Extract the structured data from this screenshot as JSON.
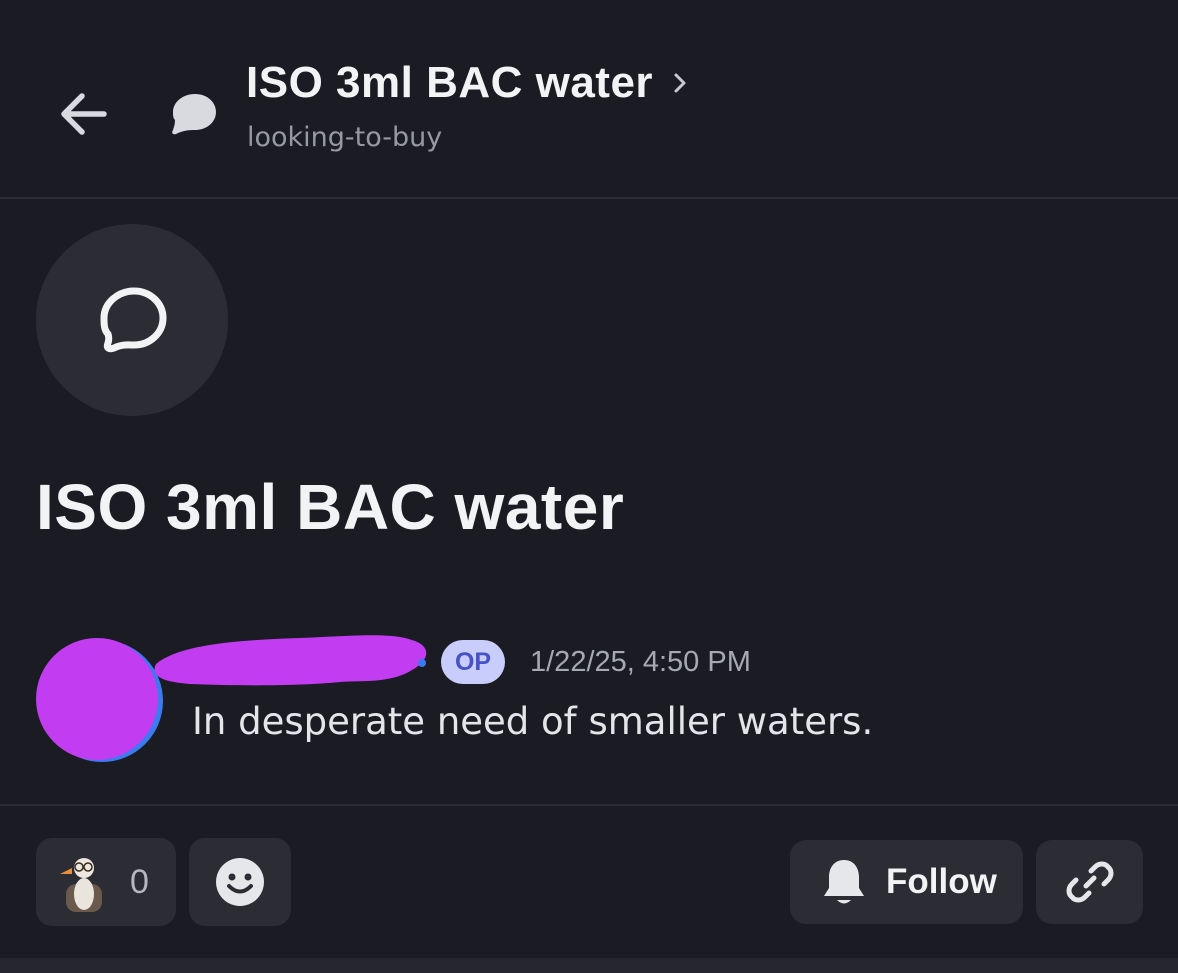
{
  "header": {
    "title": "ISO 3ml BAC water",
    "channel": "looking-to-buy",
    "back_icon": "arrow-left-icon",
    "thread_icon": "speech-bubble-icon",
    "chevron_icon": "chevron-right-icon"
  },
  "thread": {
    "title": "ISO 3ml BAC water",
    "icon": "chat-bubble-outline-icon"
  },
  "message": {
    "badge": "OP",
    "timestamp": "1/22/25, 4:50 PM",
    "text": "In desperate need of smaller waters.",
    "avatar_color": "#c23cf2"
  },
  "actions": {
    "reaction_count": "0",
    "reaction_icon": "goose-sticker-icon",
    "emoji_icon": "smiley-face-icon",
    "follow_label": "Follow",
    "follow_icon": "bell-icon",
    "link_icon": "link-icon"
  },
  "colors": {
    "background": "#1b1c23",
    "surface": "#2b2c34",
    "badge_bg": "#c9cdfb",
    "badge_text": "#4752c4",
    "muted_text": "#9698a2"
  }
}
